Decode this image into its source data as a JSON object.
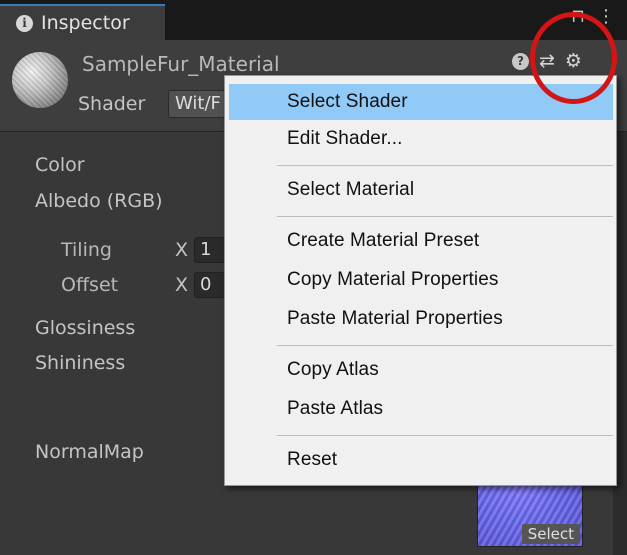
{
  "tab": {
    "label": "Inspector",
    "icon": "info-icon",
    "lock_icon": "lock-icon",
    "more_icon": "more-icon"
  },
  "material": {
    "name": "SampleFur_Material",
    "shader_label": "Shader",
    "shader_value": "Wit/F"
  },
  "properties": {
    "color": "Color",
    "albedo": "Albedo (RGB)",
    "tiling": "Tiling",
    "offset": "Offset",
    "axis_x": "X",
    "tiling_x": "1",
    "offset_x": "0",
    "glossiness": "Glossiness",
    "shininess": "Shininess",
    "normalmap": "NormalMap",
    "select": "Select"
  },
  "menu": {
    "items": [
      "Select Shader",
      "Edit Shader...",
      "Select Material",
      "Create Material Preset",
      "Copy Material Properties",
      "Paste Material Properties",
      "Copy Atlas",
      "Paste Atlas",
      "Reset"
    ],
    "selected_index": 0
  },
  "colors": {
    "highlight_circle": "#d41515",
    "menu_selection": "#91c9f7",
    "tab_accent": "#3a79bb"
  }
}
